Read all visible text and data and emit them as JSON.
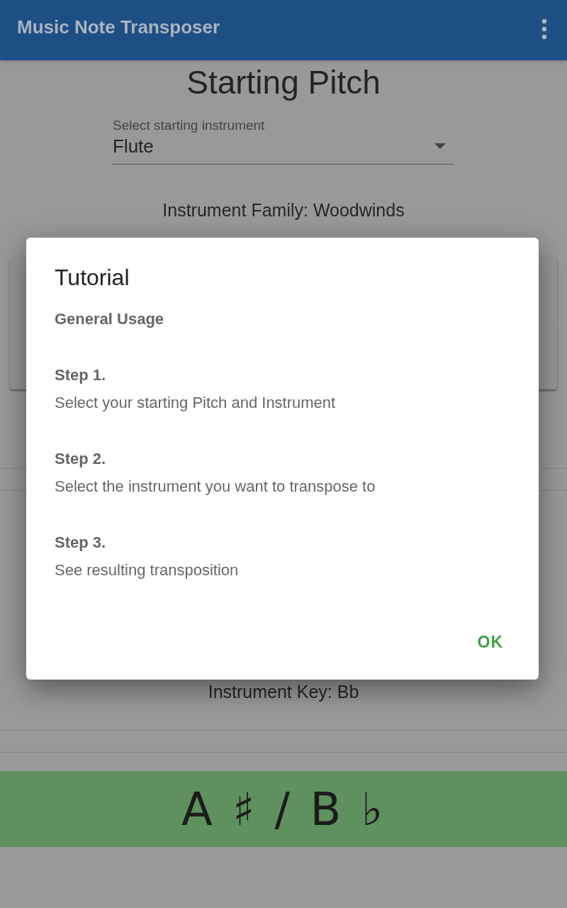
{
  "app_bar": {
    "title": "Music Note Transposer"
  },
  "starting": {
    "heading": "Starting Pitch",
    "select": {
      "label": "Select starting instrument",
      "value": "Flute"
    },
    "family": "Instrument Family: Woodwinds"
  },
  "target": {
    "key": "Instrument Key: Bb"
  },
  "result": {
    "note": "A ♯ / B ♭"
  },
  "dialog": {
    "title": "Tutorial",
    "subtitle": "General Usage",
    "steps": [
      {
        "title": "Step 1.",
        "text": "Select your starting Pitch and Instrument"
      },
      {
        "title": "Step 2.",
        "text": "Select the instrument you want to transpose to"
      },
      {
        "title": "Step 3.",
        "text": "See resulting transposition"
      }
    ],
    "button": "OK"
  }
}
